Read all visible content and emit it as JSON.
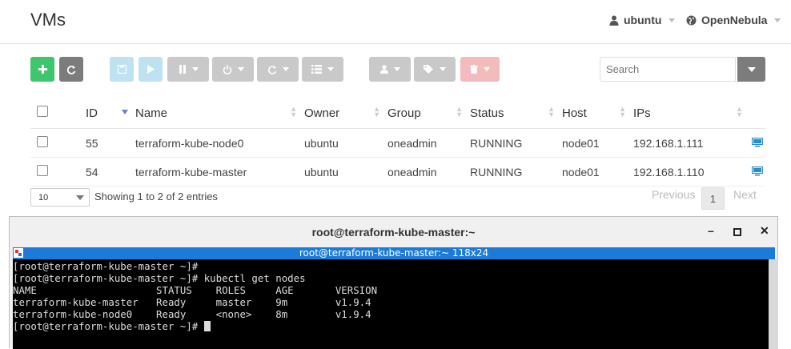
{
  "header": {
    "title": "VMs",
    "user": "ubuntu",
    "zone": "OpenNebula"
  },
  "toolbar": {
    "search_placeholder": "Search"
  },
  "table": {
    "columns": [
      "ID",
      "Name",
      "Owner",
      "Group",
      "Status",
      "Host",
      "IPs"
    ],
    "rows": [
      {
        "id": "55",
        "name": "terraform-kube-node0",
        "owner": "ubuntu",
        "group": "oneadmin",
        "status": "RUNNING",
        "host": "node01",
        "ip": "192.168.1.111"
      },
      {
        "id": "54",
        "name": "terraform-kube-master",
        "owner": "ubuntu",
        "group": "oneadmin",
        "status": "RUNNING",
        "host": "node01",
        "ip": "192.168.1.110"
      }
    ]
  },
  "footer": {
    "page_length": "10",
    "info": "Showing 1 to 2 of 2 entries",
    "previous": "Previous",
    "current_page": "1",
    "next": "Next"
  },
  "terminal": {
    "window_title": "root@terraform-kube-master:~",
    "tab_title": "root@terraform-kube-master:~ 118x24",
    "lines": [
      "[root@terraform-kube-master ~]#",
      "[root@terraform-kube-master ~]# kubectl get nodes",
      "NAME                    STATUS    ROLES     AGE       VERSION",
      "terraform-kube-master   Ready     master    9m        v1.9.4",
      "terraform-kube-node0    Ready     <none>    8m        v1.9.4",
      "[root@terraform-kube-master ~]# "
    ]
  },
  "colors": {
    "create": "#3fc66d",
    "refresh": "#7c7c7c",
    "terminal_tab": "#1a7bd8",
    "vnc_icon": "#2a8fc9"
  }
}
